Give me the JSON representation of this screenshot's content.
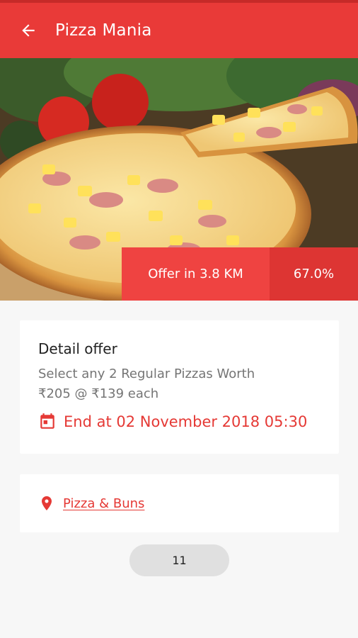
{
  "appbar": {
    "title": "Pizza Mania",
    "back_icon": "arrow-back-icon",
    "color": "#e93a38"
  },
  "hero": {
    "image": "pizza-photo",
    "offer_distance": "Offer in 3.8 KM",
    "offer_percent": "67.0%"
  },
  "detail": {
    "title": "Detail offer",
    "description_line1": "Select any 2 Regular Pizzas Worth",
    "description_line2": "₹205 @ ₹139 each",
    "calendar_icon": "calendar-icon",
    "end_text": "End at 02 November 2018  05:30",
    "accent_color": "#e53935"
  },
  "store": {
    "pin_icon": "location-pin-icon",
    "name": "Pizza & Buns"
  },
  "counter": {
    "value": "11"
  }
}
